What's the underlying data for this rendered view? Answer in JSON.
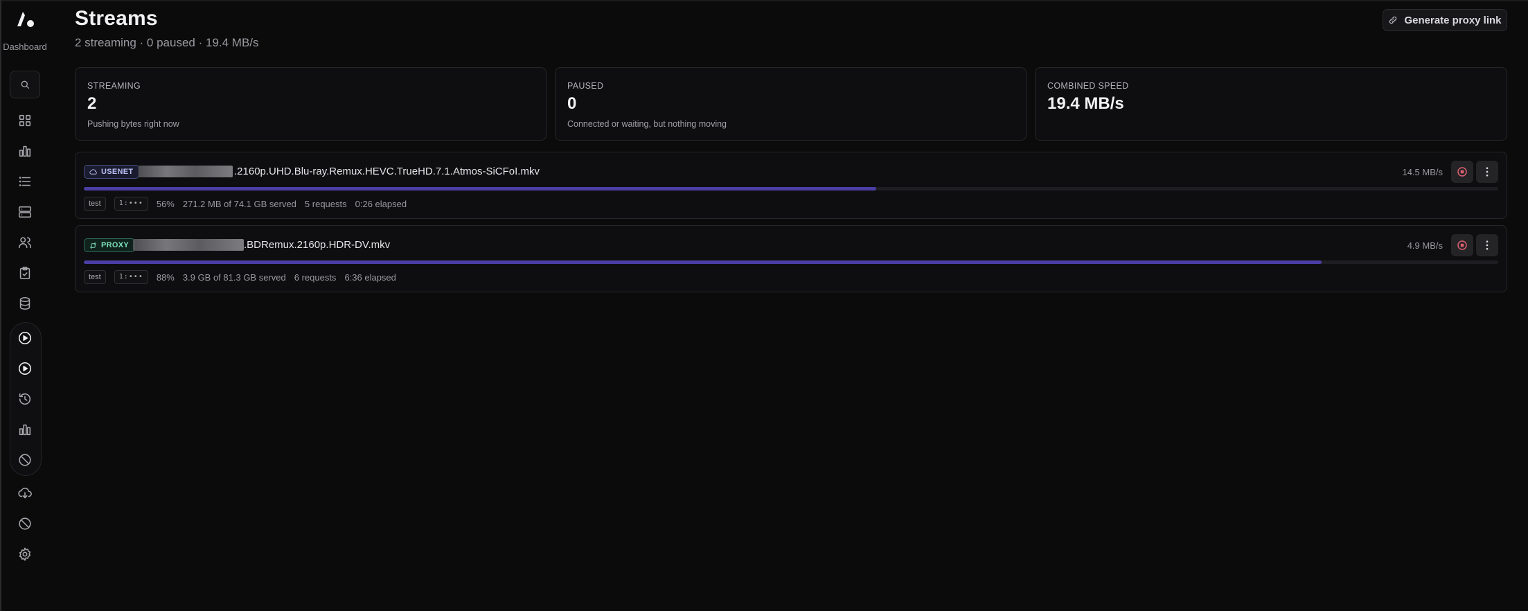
{
  "sidebar": {
    "logo_label": "Dashboard",
    "icons": [
      "search-icon",
      "grid-icon",
      "bar-chart-icon",
      "list-icon",
      "server-icon",
      "users-icon",
      "clipboard-check-icon",
      "database-icon",
      "play-circle-icon",
      "play-circle-icon",
      "history-icon",
      "bar-chart-icon",
      "ban-icon",
      "cloud-download-icon",
      "ban-icon",
      "gear-icon"
    ]
  },
  "header": {
    "title": "Streams",
    "subtitle": "2 streaming · 0 paused · 19.4 MB/s",
    "proxy_button_label": "Generate proxy link"
  },
  "stats": [
    {
      "label": "STREAMING",
      "value": "2",
      "caption": "Pushing bytes right now"
    },
    {
      "label": "PAUSED",
      "value": "0",
      "caption": "Connected or waiting, but nothing moving"
    },
    {
      "label": "COMBINED SPEED",
      "value": "19.4 MB/s",
      "caption": ""
    }
  ],
  "streams": [
    {
      "source": "USENET",
      "filename": ".2160p.UHD.Blu-ray.Remux.HEVC.TrueHD.7.1.Atmos-SiCFoI.mkv",
      "speed": "14.5 MB/s",
      "progress": 0.56,
      "user_tag": "test",
      "ip_tag": "1:•••",
      "percent": "56%",
      "served": "271.2 MB of 74.1 GB served",
      "requests": "5 requests",
      "elapsed": "0:26 elapsed"
    },
    {
      "source": "PROXY",
      "filename": ".BDRemux.2160p.HDR-DV.mkv",
      "speed": "4.9 MB/s",
      "progress": 0.875,
      "user_tag": "test",
      "ip_tag": "1:•••",
      "percent": "88%",
      "served": "3.9 GB of 81.3 GB served",
      "requests": "6 requests",
      "elapsed": "6:36 elapsed"
    }
  ],
  "colors": {
    "accent_progress": "#4b3fa6",
    "usenet_badge": "#b9bdf3",
    "proxy_badge": "#7fe0bd",
    "stop_icon": "#e06070"
  }
}
